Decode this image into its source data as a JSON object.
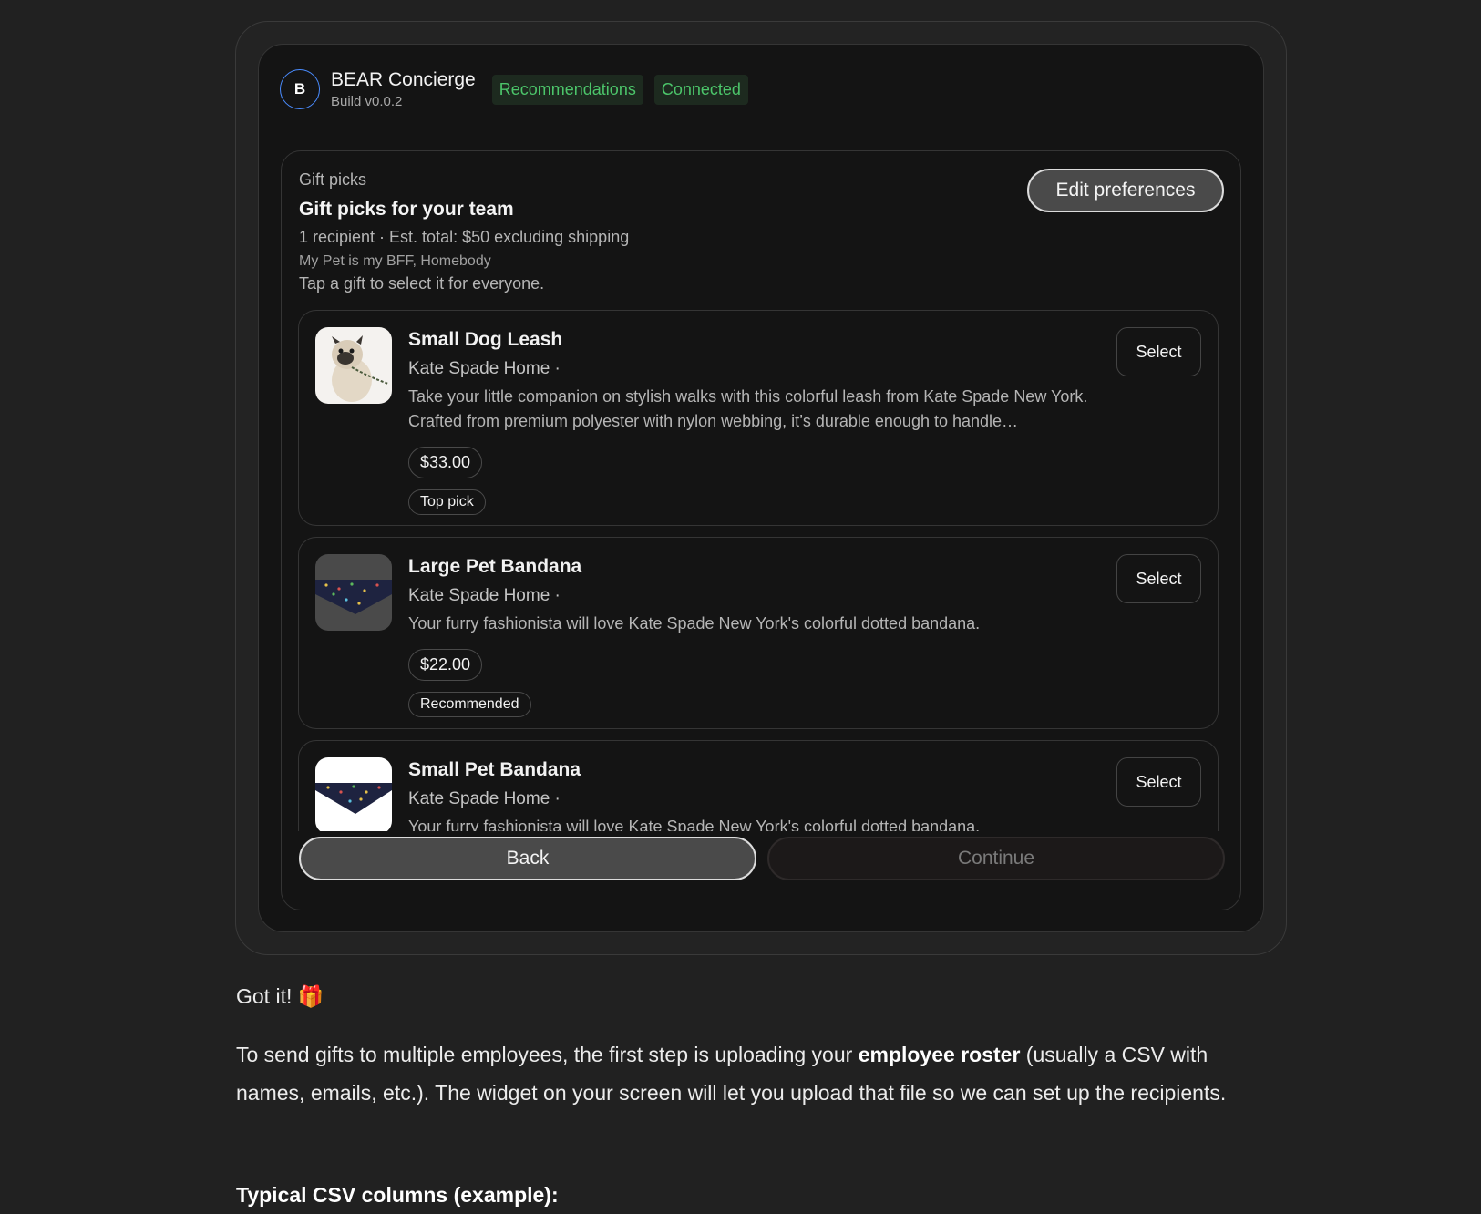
{
  "app": {
    "avatar_letter": "B",
    "title": "BEAR Concierge",
    "build": "Build v0.0.2",
    "badges": [
      "Recommendations",
      "Connected"
    ]
  },
  "section": {
    "label": "Gift picks",
    "title": "Gift picks for your team",
    "summary": "1 recipient · Est. total: $50 excluding shipping",
    "tags": "My Pet is my BFF, Homebody",
    "hint": "Tap a gift to select it for everyone.",
    "edit_button": "Edit preferences"
  },
  "items": [
    {
      "name": "Small Dog Leash",
      "brand": "Kate Spade Home ·",
      "description": "Take your little companion on stylish walks with this colorful leash from Kate Spade New York. Crafted from premium polyester with nylon webbing, it’s durable enough to handle…",
      "price": "$33.00",
      "tag": "Top pick",
      "select_label": "Select",
      "image_icon": "dog-photo"
    },
    {
      "name": "Large Pet Bandana",
      "brand": "Kate Spade Home ·",
      "description": "Your furry fashionista will love Kate Spade New York's colorful dotted bandana.",
      "price": "$22.00",
      "tag": "Recommended",
      "select_label": "Select",
      "image_icon": "bandana-photo"
    },
    {
      "name": "Small Pet Bandana",
      "brand": "Kate Spade Home ·",
      "description": "Your furry fashionista will love Kate Spade New York's colorful dotted bandana.",
      "select_label": "Select",
      "image_icon": "bandana-photo"
    }
  ],
  "footer": {
    "back_label": "Back",
    "continue_label": "Continue"
  },
  "chat": {
    "line1": "Got it! 🎁",
    "para_before": "To send gifts to multiple employees, the first step is uploading your ",
    "para_bold": "employee roster",
    "para_after": " (usually a CSV with names, emails, etc.). The widget on your screen will let you upload that file so we can set up the recipients.",
    "heading": "Typical CSV columns (example):"
  },
  "colors": {
    "background": "#212121",
    "badge_green": "#4cc56a",
    "avatar_ring": "#4a8cff"
  }
}
